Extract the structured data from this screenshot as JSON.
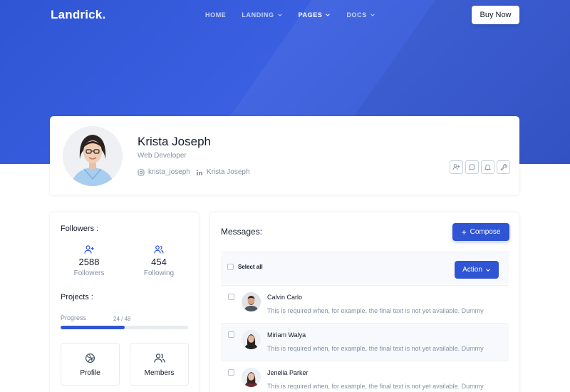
{
  "brand": {
    "logo": "Landrick.",
    "accent": "#2f55d4"
  },
  "nav": {
    "items": [
      {
        "label": "HOME",
        "active": false,
        "has_dropdown": false
      },
      {
        "label": "LANDING",
        "active": false,
        "has_dropdown": true
      },
      {
        "label": "PAGES",
        "active": true,
        "has_dropdown": true
      },
      {
        "label": "DOCS",
        "active": false,
        "has_dropdown": true
      }
    ],
    "buy_label": "Buy Now"
  },
  "profile": {
    "name": "Krista Joseph",
    "role": "Web Developer",
    "instagram": "krista_joseph",
    "linkedin": "Krista Joseph",
    "actions": [
      "user-plus-icon",
      "message-circle-icon",
      "bell-icon",
      "tool-icon"
    ]
  },
  "followers": {
    "title": "Followers :",
    "followers_count": "2588",
    "followers_label": "Followers",
    "following_count": "454",
    "following_label": "Following"
  },
  "projects": {
    "title": "Projects :",
    "progress_label": "Progress",
    "progress_text": "24 / 48",
    "progress_fraction": 0.5,
    "tiles": [
      {
        "label": "Profile",
        "icon": "dribbble-icon"
      },
      {
        "label": "Members",
        "icon": "users-icon"
      }
    ]
  },
  "messages": {
    "title": "Messages:",
    "compose_label": "Compose",
    "select_all_label": "Select all",
    "action_label": "Action",
    "items": [
      {
        "name": "Calvin Carlo",
        "text": "This is required when, for example, the final text is not yet available. Dummy"
      },
      {
        "name": "Miriam Walya",
        "text": "This is required when, for example, the final text is not yet available. Dummy"
      },
      {
        "name": "Jenelia Parker",
        "text": "This is required when, for example, the final text is not yet available. Dummy"
      }
    ]
  }
}
